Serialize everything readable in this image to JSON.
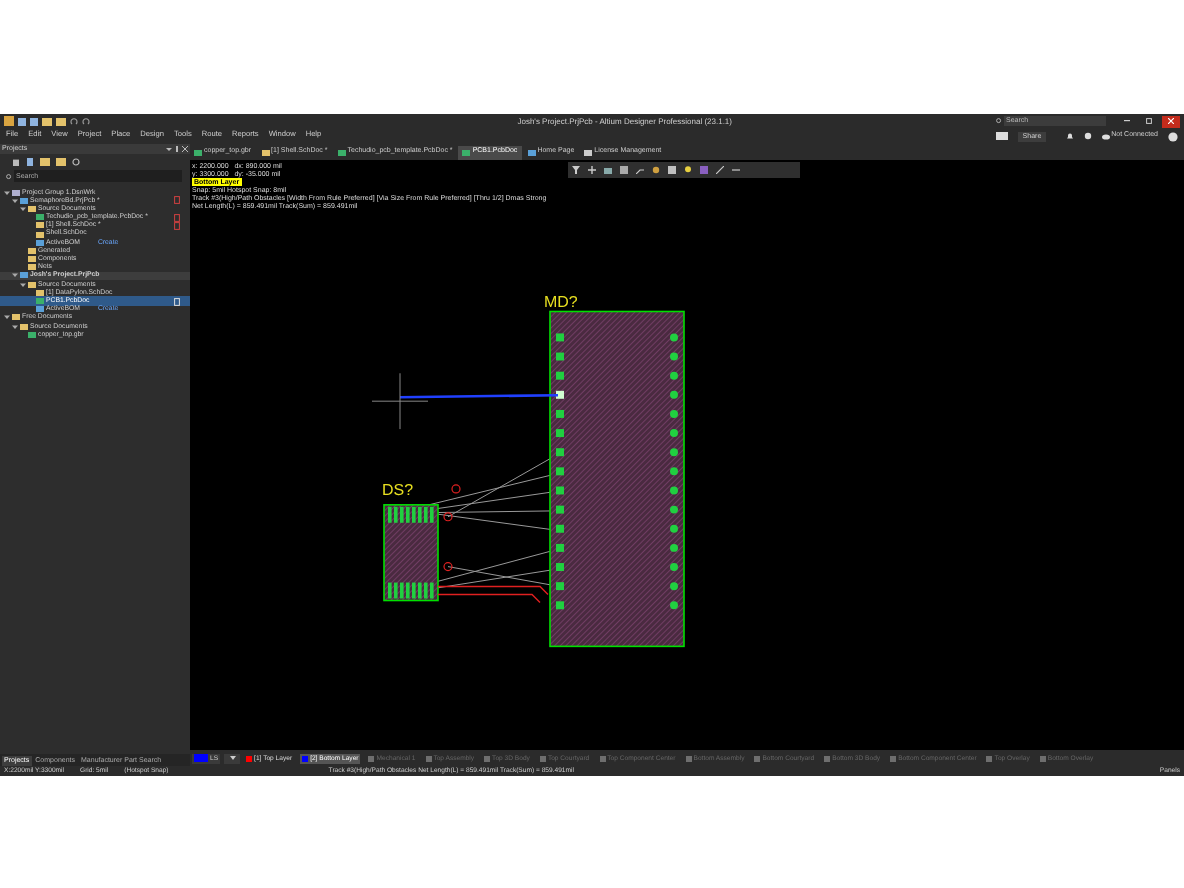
{
  "window": {
    "title": "Josh's Project.PrjPcb - Altium Designer Professional (23.1.1)",
    "search_placeholder": "Search"
  },
  "menu": [
    "File",
    "Edit",
    "View",
    "Project",
    "Place",
    "Design",
    "Tools",
    "Route",
    "Reports",
    "Window",
    "Help"
  ],
  "account": {
    "share": "Share",
    "connection": "Not Connected"
  },
  "panel": {
    "title": "Projects",
    "search_placeholder": "Search",
    "tree": [
      {
        "label": "Project Group 1.DsnWrk",
        "kind": "group",
        "selected": false,
        "children": [
          {
            "label": "SemaphoreBd.PrjPcb *",
            "kind": "project",
            "selected": false,
            "flag": true,
            "children": [
              {
                "label": "Source Documents",
                "kind": "folder",
                "selected": false,
                "children": [
                  {
                    "label": "Techudio_pcb_template.PcbDoc *",
                    "kind": "pcb",
                    "selected": false,
                    "flag": true
                  },
                  {
                    "label": "[1] Shell.SchDoc *",
                    "kind": "sch",
                    "selected": false,
                    "flag": true
                  },
                  {
                    "label": "Shell.SchDoc",
                    "kind": "sch",
                    "selected": false
                  },
                  {
                    "label": "ActiveBOM",
                    "kind": "bom",
                    "selected": false,
                    "action": "Create"
                  }
                ]
              },
              {
                "label": "Generated",
                "kind": "folder",
                "selected": false
              },
              {
                "label": "Components",
                "kind": "folder",
                "selected": false
              },
              {
                "label": "Nets",
                "kind": "folder",
                "selected": false
              }
            ]
          },
          {
            "label": "Josh's Project.PrjPcb",
            "kind": "project",
            "selected": false,
            "current": true,
            "children": [
              {
                "label": "Source Documents",
                "kind": "folder",
                "selected": false,
                "children": [
                  {
                    "label": "[1] DataPylon.SchDoc",
                    "kind": "sch",
                    "selected": false
                  },
                  {
                    "label": "PCB1.PcbDoc",
                    "kind": "pcb",
                    "selected": true,
                    "flag": true
                  },
                  {
                    "label": "ActiveBOM",
                    "kind": "bom",
                    "selected": false,
                    "action": "Create"
                  }
                ]
              }
            ]
          }
        ]
      },
      {
        "label": "Free Documents",
        "kind": "folder",
        "selected": false,
        "children": [
          {
            "label": "Source Documents",
            "kind": "folder",
            "selected": false,
            "children": [
              {
                "label": "copper_top.gbr",
                "kind": "gerber",
                "selected": false
              }
            ]
          }
        ]
      }
    ],
    "tabs": [
      {
        "label": "Projects",
        "selected": true
      },
      {
        "label": "Components",
        "selected": false
      },
      {
        "label": "Manufacturer Part Search",
        "selected": false
      }
    ]
  },
  "doc_tabs": [
    {
      "label": "copper_top.gbr",
      "kind": "gerber",
      "selected": false
    },
    {
      "label": "[1] Shell.SchDoc *",
      "kind": "sch",
      "selected": false
    },
    {
      "label": "Techudio_pcb_template.PcbDoc *",
      "kind": "pcb",
      "selected": false
    },
    {
      "label": "PCB1.PcbDoc",
      "kind": "pcb",
      "selected": true
    },
    {
      "label": "Home Page",
      "kind": "home",
      "selected": false
    },
    {
      "label": "License Management",
      "kind": "license",
      "selected": false
    }
  ],
  "heads_up": {
    "lines": [
      "x: 2200.000   dx: 890.000 mil",
      "y: 3300.000   dy: -35.000 mil"
    ],
    "layer": "Bottom Layer",
    "details": [
      "Snap: 5mil Hotspot Snap: 8mil",
      "Track #3(High/Path Obstacles [Width From Rule Preferred] [Via Size From Rule Preferred] [Thru 1/2] Dmas Strong",
      "Net Length(L) = 859.491mil Track(Sum) = 859.491mil"
    ]
  },
  "designators": [
    {
      "label": "MD?"
    },
    {
      "label": "DS?"
    }
  ],
  "layer_set": "LS",
  "layers": [
    {
      "label": "[1] Top Layer",
      "color": "#ff0000",
      "selected": false
    },
    {
      "label": "[2] Bottom Layer",
      "color": "#0000ff",
      "selected": true
    },
    {
      "label": "Mechanical 1",
      "color": "#6e6e6e",
      "selected": false
    },
    {
      "label": "Top Assembly",
      "color": "#6e6e6e",
      "selected": false
    },
    {
      "label": "Top 3D Body",
      "color": "#6e6e6e",
      "selected": false
    },
    {
      "label": "Top Courtyard",
      "color": "#6e6e6e",
      "selected": false
    },
    {
      "label": "Top Component Center",
      "color": "#6e6e6e",
      "selected": false
    },
    {
      "label": "Bottom Assembly",
      "color": "#6e6e6e",
      "selected": false
    },
    {
      "label": "Bottom Courtyard",
      "color": "#6e6e6e",
      "selected": false
    },
    {
      "label": "Bottom 3D Body",
      "color": "#6e6e6e",
      "selected": false
    },
    {
      "label": "Bottom Component Center",
      "color": "#6e6e6e",
      "selected": false
    },
    {
      "label": "Top Overlay",
      "color": "#6e6e6e",
      "selected": false
    },
    {
      "label": "Bottom Overlay",
      "color": "#6e6e6e",
      "selected": false
    }
  ],
  "status": {
    "left": [
      "X:2200mil Y:3300mil",
      "Grid: 5mil",
      "(Hotspot Snap)"
    ],
    "center": "Track #3(High/Path Obstacles Net Length(L) = 859.491mil Track(Sum) = 859.491mil",
    "right": "Panels"
  }
}
